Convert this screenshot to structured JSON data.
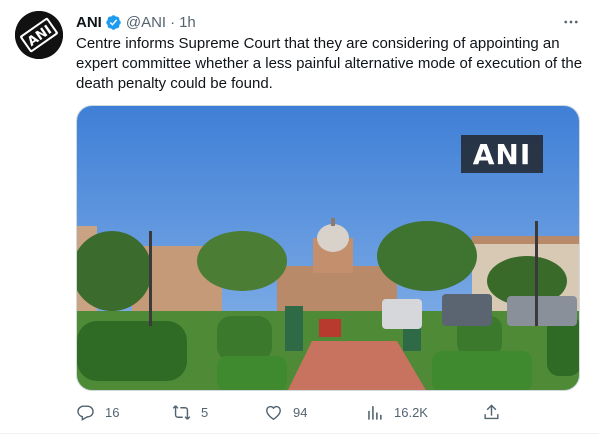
{
  "tweet": {
    "author_name": "ANI",
    "handle": "@ANI",
    "separator": "·",
    "time": "1h",
    "text": "Centre informs Supreme Court that they are considering of appointing an expert committee whether a less painful alternative mode of execution of the death penalty could be found.",
    "avatar_text": "ANI",
    "media": {
      "watermark": "ANI"
    },
    "actions": {
      "replies": "16",
      "retweets": "5",
      "likes": "94",
      "views": "16.2K"
    }
  },
  "colors": {
    "verified": "#1d9bf0",
    "secondary_text": "#536471",
    "border": "#cfd9de"
  },
  "icons": [
    "ani-logo",
    "verified-badge-icon",
    "more-icon",
    "reply-icon",
    "retweet-icon",
    "like-icon",
    "views-icon",
    "share-icon"
  ]
}
